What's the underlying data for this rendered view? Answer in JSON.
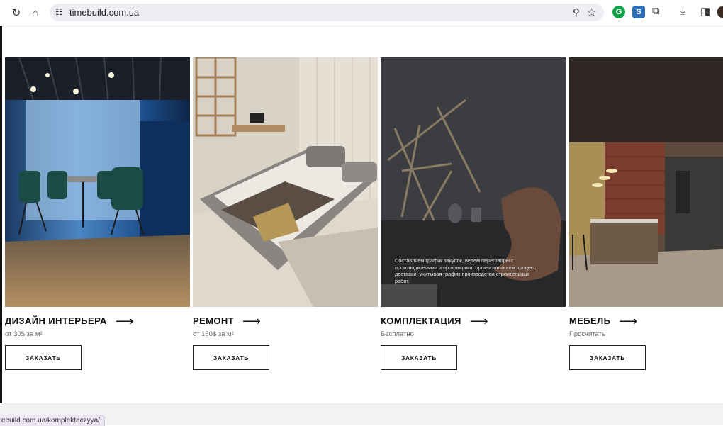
{
  "browser": {
    "url": "timebuild.com.ua",
    "status_url": "ebuild.com.ua/komplektaczyya/"
  },
  "cards": [
    {
      "title": "ДИЗАЙН ИНТЕРЬЕРА",
      "arrow": "⟶",
      "price": "от 30$ за м²",
      "button": "ЗАКАЗАТЬ"
    },
    {
      "title": "РЕМОНТ",
      "arrow": "⟶",
      "price": "от 150$ за м²",
      "button": "ЗАКАЗАТЬ"
    },
    {
      "title": "КОМПЛЕКТАЦИЯ",
      "arrow": "⟶",
      "price": "Бесплатно",
      "button": "ЗАКАЗАТЬ",
      "overlay": "Составляем график закупок, ведем переговоры с производителями и продавцами, организовываем процесс доставки, учитывая график производства строительных работ."
    },
    {
      "title": "МЕБЕЛЬ",
      "arrow": "⟶",
      "price": "Просчитать",
      "button": "ЗАКАЗАТЬ"
    }
  ]
}
